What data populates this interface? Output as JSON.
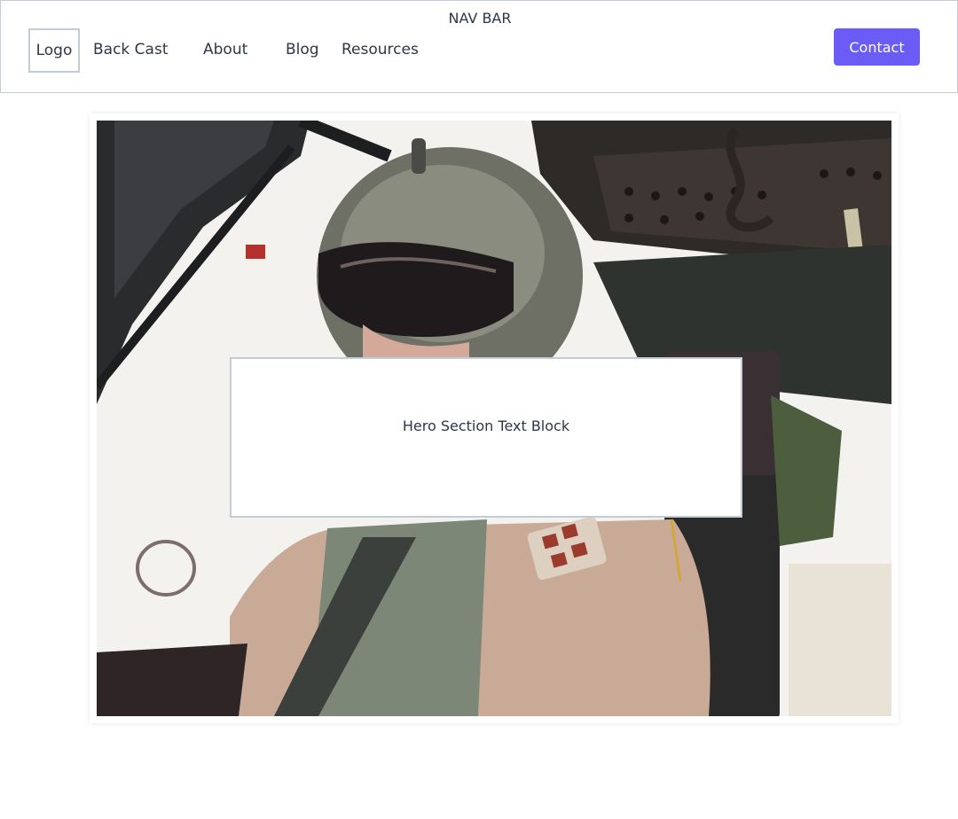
{
  "navbar": {
    "title": "NAV BAR",
    "logo_label": "Logo",
    "links": [
      {
        "label": "Back Cast"
      },
      {
        "label": "About"
      },
      {
        "label": "Blog"
      },
      {
        "label": "Resources"
      }
    ],
    "contact_label": "Contact"
  },
  "hero": {
    "text_block": "Hero Section Text Block",
    "image_subject": "helicopter-pilot-photo"
  },
  "colors": {
    "accent": "#6a5cf5",
    "border": "#c3ccd6",
    "text": "#2d3748"
  }
}
